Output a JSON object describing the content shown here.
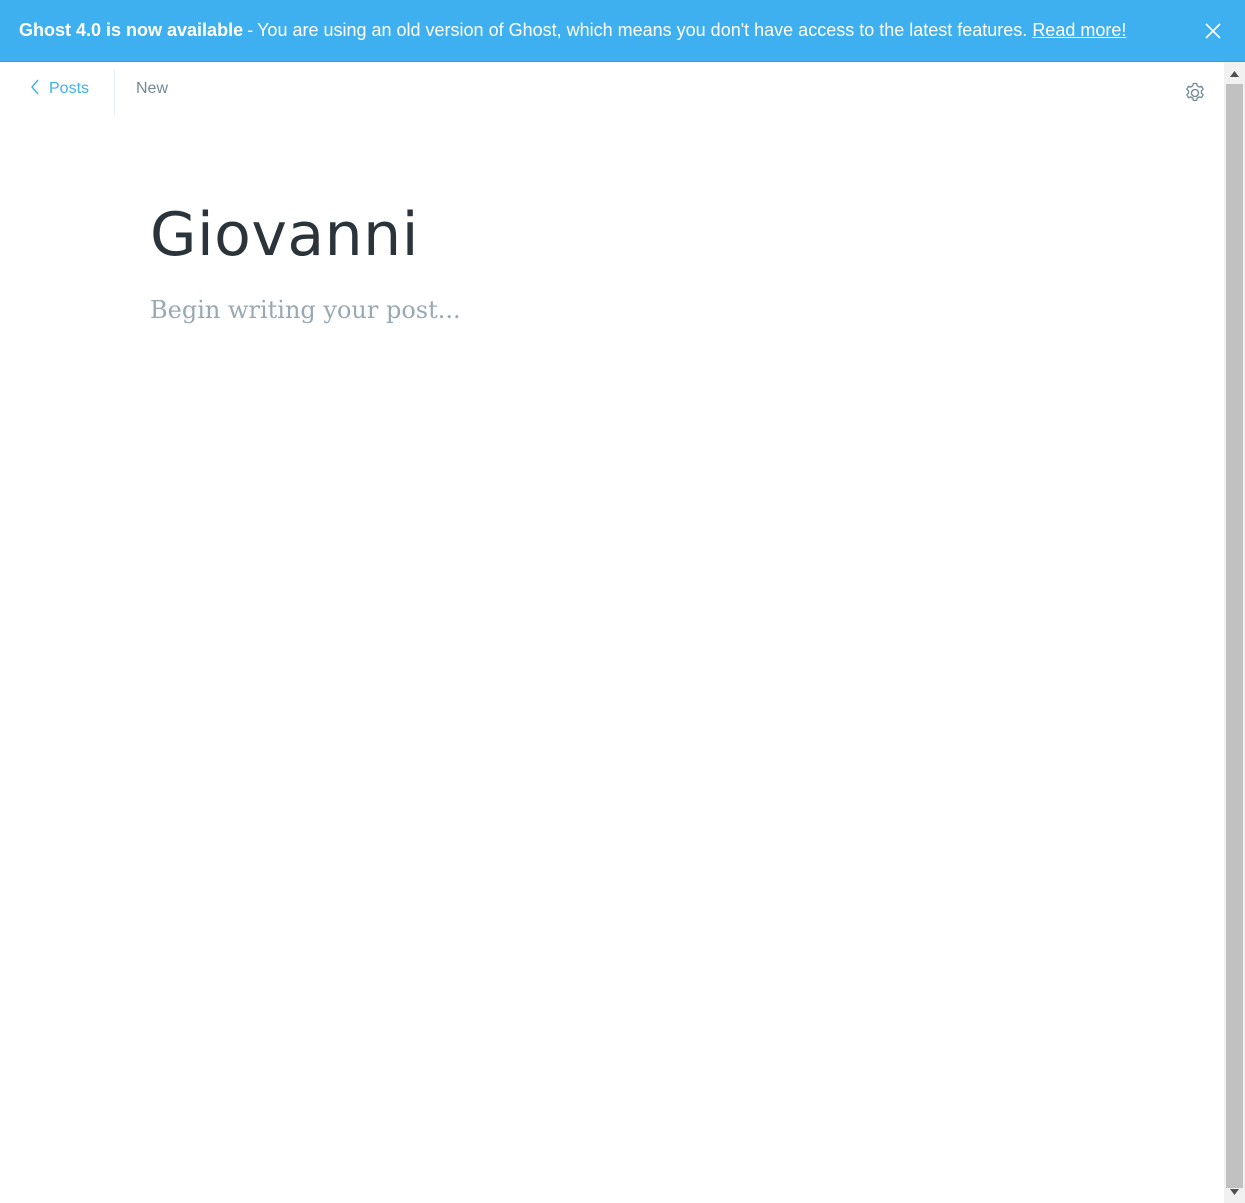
{
  "banner": {
    "title": "Ghost 4.0 is now available",
    "separator": "-",
    "message": "You are using an old version of Ghost, which means you don't have access to the latest features.",
    "link": "Read more!",
    "close_icon": "close-icon",
    "color": "#3eb0ef"
  },
  "header": {
    "back_label": "Posts",
    "back_icon": "chevron-left-icon",
    "status": "New",
    "settings_icon": "gear-icon"
  },
  "editor": {
    "title": "Giovanni",
    "body_placeholder": "Begin writing your post..."
  },
  "colors": {
    "accent": "#3eb0ef",
    "title_text": "#2b343a",
    "muted_text": "#738a94",
    "placeholder": "#99a9b3"
  }
}
